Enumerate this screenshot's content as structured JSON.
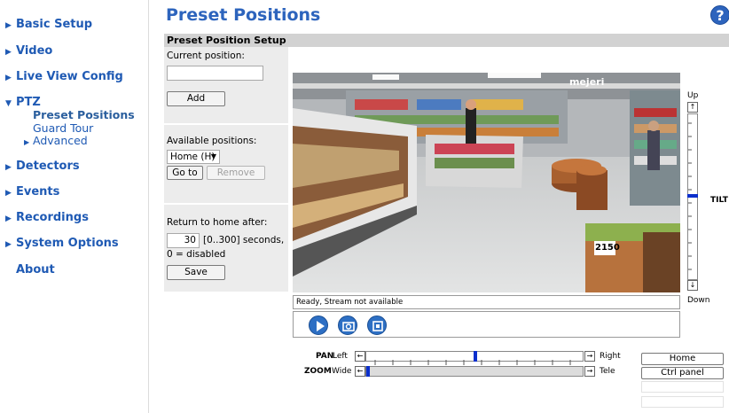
{
  "sidebar": {
    "items": [
      {
        "label": "Basic Setup",
        "expanded": false
      },
      {
        "label": "Video",
        "expanded": false
      },
      {
        "label": "Live View Config",
        "expanded": false
      },
      {
        "label": "PTZ",
        "expanded": true
      },
      {
        "label": "Detectors",
        "expanded": false
      },
      {
        "label": "Events",
        "expanded": false
      },
      {
        "label": "Recordings",
        "expanded": false
      },
      {
        "label": "System Options",
        "expanded": false
      },
      {
        "label": "About",
        "expanded": false
      }
    ],
    "ptz_sub": [
      {
        "label": "Preset Positions",
        "active": true
      },
      {
        "label": "Guard Tour",
        "active": false
      },
      {
        "label": "Advanced",
        "active": false
      }
    ]
  },
  "header": {
    "title": "Preset Positions",
    "help_icon": "question-mark-icon"
  },
  "section": {
    "title": "Preset Position Setup"
  },
  "form": {
    "current_position_label": "Current position:",
    "current_position_value": "",
    "add_label": "Add",
    "available_label": "Available positions:",
    "selected_position": "Home (H)",
    "goto_label": "Go to",
    "remove_label": "Remove",
    "return_label": "Return to home after:",
    "return_value": "30",
    "return_range": "[0..300] seconds,",
    "disabled_note": "0 = disabled",
    "save_label": "Save"
  },
  "video": {
    "store_sign": "mejeri",
    "price_tag": "2150",
    "status": "Ready, Stream not available"
  },
  "controls": {
    "play_icon": "play-icon",
    "snapshot_icon": "camera-icon",
    "fullscreen_icon": "fullscreen-icon"
  },
  "ptz": {
    "tilt_up": "Up",
    "tilt_down": "Down",
    "tilt_label": "TILT",
    "tilt_level": 0.5,
    "pan_label": "PAN",
    "pan_left": "Left",
    "pan_right": "Right",
    "pan_level": 0.5,
    "zoom_label": "ZOOM",
    "zoom_wide": "Wide",
    "zoom_tele": "Tele",
    "zoom_level": 0.0
  },
  "buttons": {
    "home": "Home",
    "ctrl_panel": "Ctrl panel"
  },
  "colors": {
    "link": "#1f5ab4",
    "title": "#2d64bd",
    "indicator": "#0b2fcc"
  }
}
